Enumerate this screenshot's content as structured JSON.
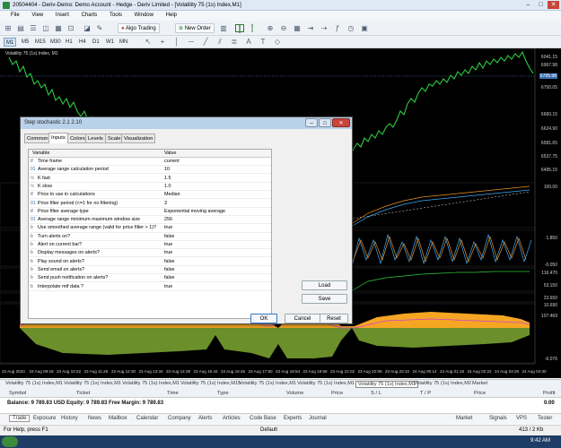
{
  "window": {
    "title": "20504404 - Deriv-Demo: Demo Account - Hedge - Deriv Limited - [Volatility 75 (1s) Index,M1]"
  },
  "menu": [
    "File",
    "View",
    "Insert",
    "Charts",
    "Tools",
    "Window",
    "Help"
  ],
  "toolbar": {
    "algo_trading": "Algo Trading",
    "new_order": "New Order"
  },
  "timeframes": [
    "M1",
    "M5",
    "M15",
    "M30",
    "H1",
    "H4",
    "D1",
    "W1",
    "MN"
  ],
  "active_timeframe": "M1",
  "chart": {
    "title": "Volatility 75 (1s) Index, M1",
    "price_labels": [
      "6041.15",
      "6967.98",
      "6794.84",
      "6750.05",
      "6660.15",
      "6624.90",
      "6581.65",
      "6537.75",
      "6495.15"
    ],
    "current_price": "6795.98",
    "indicator_labels": [
      "100.00",
      "1.850",
      "-0.050",
      "116.470",
      "53.150",
      "23.650",
      "10.690",
      "107.469",
      "-6.076"
    ],
    "time_labels": [
      "23 Aug 2023",
      "23 Aug 09:18",
      "23 Aug 10:22",
      "23 Aug 11:26",
      "23 Aug 12:30",
      "23 Aug 13:34",
      "23 Aug 14:38",
      "23 Aug 15:42",
      "23 Aug 16:46",
      "23 Aug 17:50",
      "23 Aug 18:54",
      "23 Aug 19:58",
      "23 Aug 21:02",
      "23 Aug 22:06",
      "23 Aug 23:10",
      "24 Aug 00:14",
      "24 Aug 01:18",
      "24 Aug 02:22",
      "24 Aug 03:26",
      "24 Aug 04:30"
    ]
  },
  "dialog": {
    "title": "Step stochastic 2.1 2.10",
    "tabs": [
      "Common",
      "Inputs",
      "Colors",
      "Levels",
      "Scale",
      "Visualization"
    ],
    "active_tab": "Inputs",
    "headers": {
      "variable": "Variable",
      "value": "Value"
    },
    "rows": [
      {
        "icon": "tf",
        "variable": "Time frame",
        "value": "current"
      },
      {
        "icon": "01",
        "variable": "Average range calculation period",
        "value": "10"
      },
      {
        "icon": "½",
        "variable": "K fast",
        "value": "1.5"
      },
      {
        "icon": "½",
        "variable": "K slow",
        "value": "1.0"
      },
      {
        "icon": "tf",
        "variable": "Price to use in calculations",
        "value": "Median"
      },
      {
        "icon": "01",
        "variable": "Price filter period (<=1 for no filtering)",
        "value": "3"
      },
      {
        "icon": "tf",
        "variable": "Price filter average type",
        "value": "Exponential moving average"
      },
      {
        "icon": "01",
        "variable": "Average range minimum maximum window size",
        "value": "256"
      },
      {
        "icon": "b",
        "variable": "Use smoothed average range (valid for price filter > 1)?",
        "value": "true"
      },
      {
        "icon": "b",
        "variable": "Turn alerts on?",
        "value": "false"
      },
      {
        "icon": "b",
        "variable": "Alert on current bar?",
        "value": "true"
      },
      {
        "icon": "b",
        "variable": "Display messages on alerts?",
        "value": "true"
      },
      {
        "icon": "b",
        "variable": "Play sound on alerts?",
        "value": "false"
      },
      {
        "icon": "b",
        "variable": "Send email on alerts?",
        "value": "false"
      },
      {
        "icon": "b",
        "variable": "Send push notification on alerts?",
        "value": "false"
      },
      {
        "icon": "b",
        "variable": "Interpolate mtf data ?",
        "value": "true"
      }
    ],
    "load": "Load",
    "save": "Save",
    "ok": "OK",
    "cancel": "Cancel",
    "reset": "Reset"
  },
  "symbol_tabs": [
    "Volatility 75 (1s) Index,M1",
    "Volatility 75 (1s) Index,M1",
    "Volatility 75 (1s) Index,M1",
    "Volatility 75 (1s) Index,M15",
    "Volatility 75 (1s) Index,M1",
    "Volatility 75 (1s) Index,M1",
    "Volatility 75 (1s) Index,M1",
    "Volatility 75 (1s) Index,M2",
    "Market"
  ],
  "symbol_tab_active": 6,
  "terminal": {
    "headers": [
      "Symbol",
      "Ticket",
      "Time",
      "Type",
      "Volume",
      "Price",
      "S / L",
      "T / P",
      "Price",
      "Profit"
    ],
    "balance": "Balance: 9 789.83 USD  Equity: 9 789.83  Free Margin: 9 789.83",
    "profit": "0.00",
    "tabs": [
      "Trade",
      "Exposure",
      "History",
      "News",
      "Mailbox",
      "Calendar",
      "Company",
      "Alerts",
      "Articles",
      "Code Base",
      "Experts",
      "Journal"
    ],
    "right_tabs": [
      "Market",
      "Signals",
      "VPS",
      "Tester"
    ]
  },
  "status": {
    "help": "For Help, press F1",
    "profile": "Default",
    "traffic": "413 / 2 Kb"
  },
  "taskbar": {
    "time": "9:42 AM"
  }
}
